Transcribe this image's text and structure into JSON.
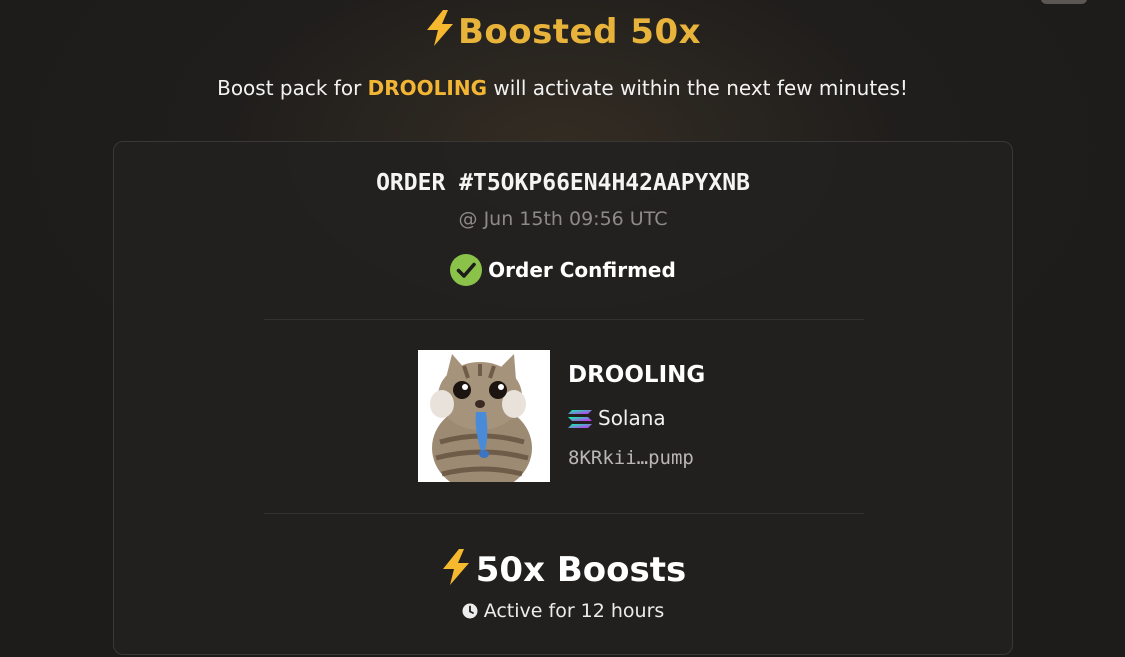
{
  "header": {
    "title": "Boosted 50x",
    "subtitle_before": "Boost pack for ",
    "subtitle_token": "DROOLING",
    "subtitle_after": " will activate within the next few minutes!"
  },
  "order": {
    "id_label": "ORDER #T5OKP66EN4H42AAPYXNB",
    "timestamp": "@ Jun 15th 09:56 UTC",
    "status": "Order Confirmed"
  },
  "token": {
    "name": "DROOLING",
    "chain": "Solana",
    "address": "8KRkii…pump"
  },
  "boost": {
    "title": "50x Boosts",
    "duration": "Active for 12 hours"
  },
  "icons": {
    "title_icon": "lightning-icon",
    "status_icon": "check-circle-icon",
    "chain_icon": "solana-icon",
    "boost_icon": "lightning-icon",
    "duration_icon": "clock-icon"
  },
  "colors": {
    "accent": "#e8b33a",
    "token_highlight": "#f2b534",
    "success": "#8bc34a",
    "background": "#1d1c1b"
  }
}
